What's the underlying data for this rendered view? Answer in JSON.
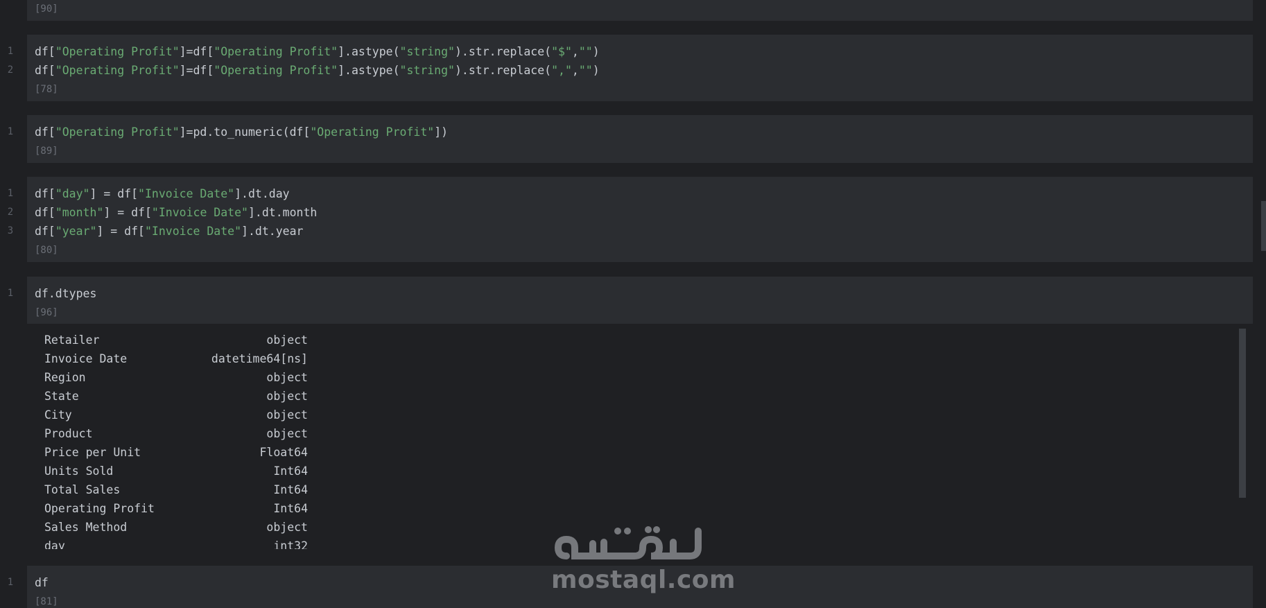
{
  "cells": [
    {
      "id": "c0",
      "exec_count": "[90]",
      "lines": []
    },
    {
      "id": "c1",
      "exec_count": "[78]",
      "lines": [
        {
          "no": "1",
          "tokens": [
            {
              "t": "df["
            },
            {
              "t": "\"Operating Profit\"",
              "k": "str"
            },
            {
              "t": "]=df["
            },
            {
              "t": "\"Operating Profit\"",
              "k": "str"
            },
            {
              "t": "].astype("
            },
            {
              "t": "\"string\"",
              "k": "str"
            },
            {
              "t": ").str.replace("
            },
            {
              "t": "\"$\"",
              "k": "str"
            },
            {
              "t": ","
            },
            {
              "t": "\"\"",
              "k": "str"
            },
            {
              "t": ")"
            }
          ]
        },
        {
          "no": "2",
          "tokens": [
            {
              "t": "df["
            },
            {
              "t": "\"Operating Profit\"",
              "k": "str"
            },
            {
              "t": "]=df["
            },
            {
              "t": "\"Operating Profit\"",
              "k": "str"
            },
            {
              "t": "].astype("
            },
            {
              "t": "\"string\"",
              "k": "str"
            },
            {
              "t": ").str.replace("
            },
            {
              "t": "\",\"",
              "k": "str"
            },
            {
              "t": ","
            },
            {
              "t": "\"\"",
              "k": "str"
            },
            {
              "t": ")"
            }
          ]
        }
      ]
    },
    {
      "id": "c2",
      "exec_count": "[89]",
      "lines": [
        {
          "no": "1",
          "tokens": [
            {
              "t": "df["
            },
            {
              "t": "\"Operating Profit\"",
              "k": "str"
            },
            {
              "t": "]=pd.to_numeric(df["
            },
            {
              "t": "\"Operating Profit\"",
              "k": "str"
            },
            {
              "t": "])"
            }
          ]
        }
      ]
    },
    {
      "id": "c3",
      "exec_count": "[80]",
      "lines": [
        {
          "no": "1",
          "tokens": [
            {
              "t": "df["
            },
            {
              "t": "\"day\"",
              "k": "str"
            },
            {
              "t": "] = df["
            },
            {
              "t": "\"Invoice Date\"",
              "k": "str"
            },
            {
              "t": "].dt.day"
            }
          ]
        },
        {
          "no": "2",
          "tokens": [
            {
              "t": "df["
            },
            {
              "t": "\"month\"",
              "k": "str"
            },
            {
              "t": "] = df["
            },
            {
              "t": "\"Invoice Date\"",
              "k": "str"
            },
            {
              "t": "].dt.month"
            }
          ]
        },
        {
          "no": "3",
          "tokens": [
            {
              "t": "df["
            },
            {
              "t": "\"year\"",
              "k": "str"
            },
            {
              "t": "] = df["
            },
            {
              "t": "\"Invoice Date\"",
              "k": "str"
            },
            {
              "t": "].dt.year"
            }
          ]
        }
      ]
    },
    {
      "id": "c4",
      "exec_count": "[96]",
      "lines": [
        {
          "no": "1",
          "tokens": [
            {
              "t": "df.dtypes"
            }
          ]
        }
      ]
    },
    {
      "id": "c5",
      "exec_count": "[81]",
      "lines": [
        {
          "no": "1",
          "tokens": [
            {
              "t": "df"
            }
          ]
        }
      ]
    }
  ],
  "dtypes_output": [
    {
      "name": "Retailer",
      "type": "object"
    },
    {
      "name": "Invoice Date",
      "type": "datetime64[ns]"
    },
    {
      "name": "Region",
      "type": "object"
    },
    {
      "name": "State",
      "type": "object"
    },
    {
      "name": "City",
      "type": "object"
    },
    {
      "name": "Product",
      "type": "object"
    },
    {
      "name": "Price per Unit",
      "type": "Float64"
    },
    {
      "name": "Units Sold",
      "type": "Int64"
    },
    {
      "name": "Total Sales",
      "type": "Int64"
    },
    {
      "name": "Operating Profit",
      "type": "Int64"
    },
    {
      "name": "Sales Method",
      "type": "object"
    },
    {
      "name": "day",
      "type": "int32"
    }
  ],
  "watermark": {
    "text": "mostaql.com",
    "logo_label": "mostaql-logo"
  },
  "colors": {
    "background": "#1f2023",
    "cell_background": "#2b2d31",
    "string_literal": "#6aab73",
    "code_text": "#c9cdd3",
    "exec_count": "#6b6f77",
    "line_number": "#5c6068"
  }
}
